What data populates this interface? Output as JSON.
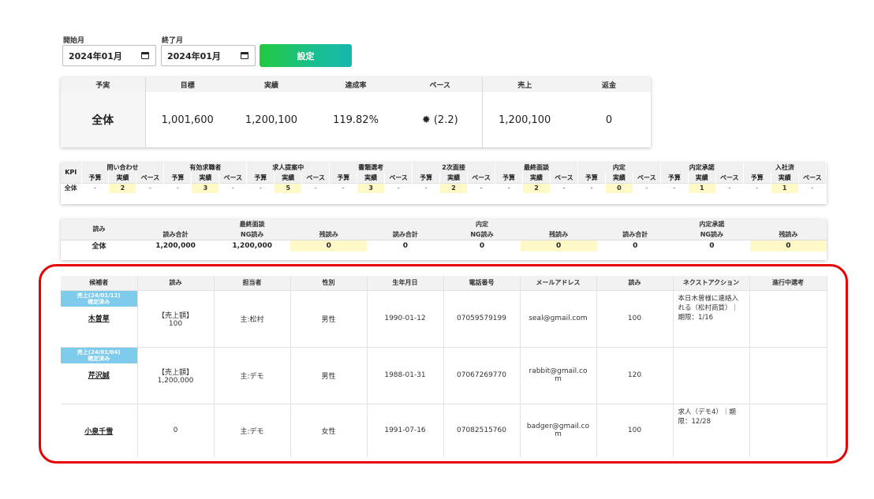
{
  "filters": {
    "start_label": "開始月",
    "end_label": "終了月",
    "start_value": "2024年01月",
    "end_value": "2024年01月",
    "set_button": "設定"
  },
  "summary": {
    "headers": [
      "予実",
      "目標",
      "実績",
      "達成率",
      "ペース",
      "売上",
      "返金"
    ],
    "row": {
      "label": "全体",
      "target": "1,001,600",
      "actual": "1,200,100",
      "rate": "119.82%",
      "pace": "(2.2)",
      "sales": "1,200,100",
      "refund": "0"
    },
    "pace_icon": "sun-icon",
    "pace_color": "#e0403a"
  },
  "kpi": {
    "corner": "KPI",
    "stages": [
      "問い合わせ",
      "有効求職者",
      "求人提案中",
      "書類選考",
      "2次面接",
      "最終面談",
      "内定",
      "内定承諾",
      "入社済"
    ],
    "sub": [
      "予算",
      "実績",
      "ペース"
    ],
    "row_label": "全体",
    "rows": [
      [
        "-",
        "2",
        "-"
      ],
      [
        "-",
        "3",
        "-"
      ],
      [
        "-",
        "5",
        "-"
      ],
      [
        "-",
        "3",
        "-"
      ],
      [
        "-",
        "2",
        "-"
      ],
      [
        "-",
        "2",
        "-"
      ],
      [
        "-",
        "0",
        "-"
      ],
      [
        "-",
        "1",
        "-"
      ],
      [
        "-",
        "1",
        "-"
      ]
    ]
  },
  "yomi": {
    "corner": "読み",
    "groups": [
      "最終面談",
      "内定",
      "内定承諾"
    ],
    "sub": [
      "読み合計",
      "NG読み",
      "残読み"
    ],
    "row_label": "全体",
    "values": [
      "1,200,000",
      "1,200,000",
      "0",
      "0",
      "0",
      "0",
      "0",
      "0",
      "0"
    ]
  },
  "candidates": {
    "headers": [
      "候補者",
      "読み",
      "担当者",
      "性別",
      "生年月日",
      "電話番号",
      "メールアドレス",
      "読み",
      "ネクストアクション",
      "進行中選考"
    ],
    "rows": [
      {
        "badge_line1": "売上(24/01/12)",
        "badge_line2": "確定済み",
        "name": "木曽草",
        "yomi_line1": "【売上額】",
        "yomi_line2": "100",
        "owner": "主:松村",
        "gender": "男性",
        "birth": "1990-01-12",
        "phone": "07059579199",
        "email": "seal@gmail.com",
        "yomi2": "100",
        "next": "本日木曽様に連絡入れる（松村商質）｜期限：1/16",
        "progress": ""
      },
      {
        "badge_line1": "売上(24/01/04)",
        "badge_line2": "確定済み",
        "name": "芹沢誠",
        "yomi_line1": "【売上額】",
        "yomi_line2": "1,200,000",
        "owner": "主:デモ",
        "gender": "男性",
        "birth": "1988-01-31",
        "phone": "07067269770",
        "email": "rabbit@gmail.com",
        "yomi2": "120",
        "next": "",
        "progress": ""
      },
      {
        "badge_line1": "",
        "badge_line2": "",
        "name": "小泉千雪",
        "yomi_line1": "0",
        "yomi_line2": "",
        "owner": "主:デモ",
        "gender": "女性",
        "birth": "1991-07-16",
        "phone": "07082515760",
        "email": "badger@gmail.com",
        "yomi2": "100",
        "next": "求人（デモ4）｜期限：12/28",
        "progress": ""
      }
    ]
  },
  "colors": {
    "accent_green": "#22c83f",
    "badge_blue": "#7ecbeb",
    "highlight_yellow": "#fff9c8",
    "annotation_red": "#e60000"
  }
}
